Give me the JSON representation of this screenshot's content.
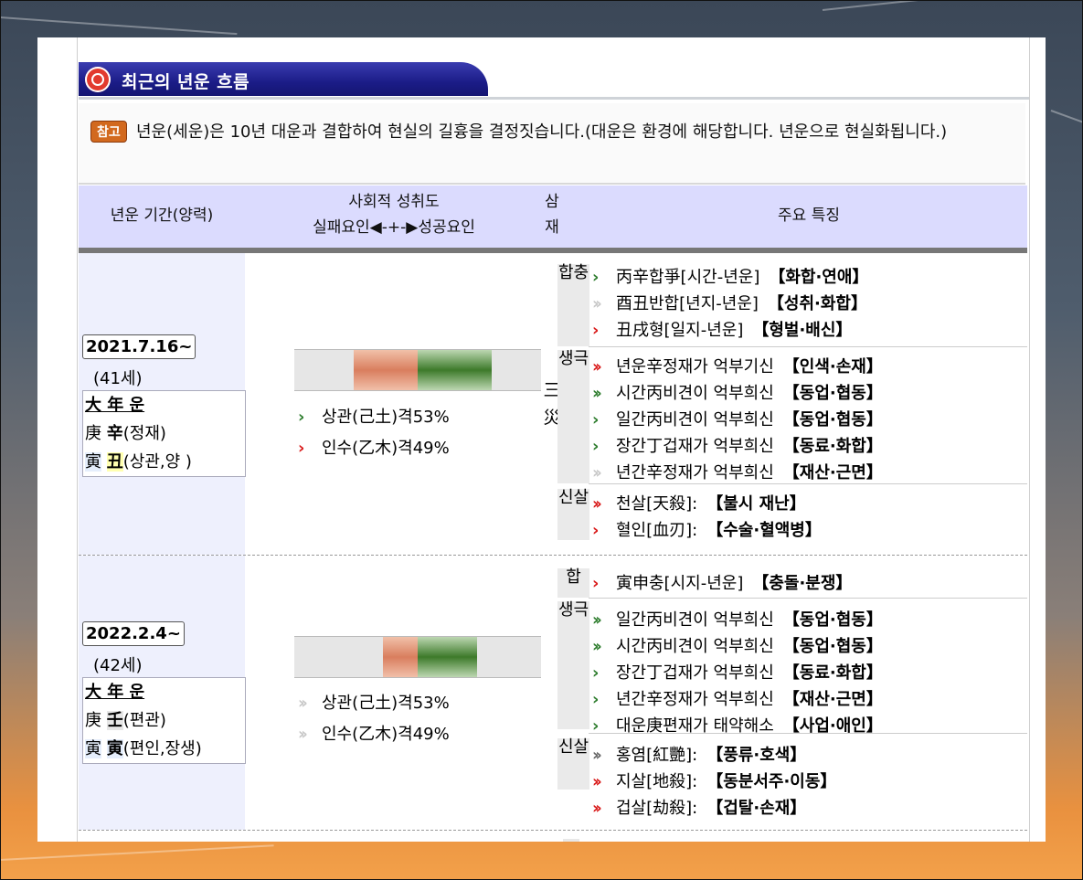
{
  "section_title": "최근의 년운 흐름",
  "note": {
    "badge": "참고",
    "text": "년운(세운)은 10년 대운과 결합하여 현실의 길흉을 결정짓습니다.(대운은 환경에 해당합니다. 년운으로 현실화됩니다.)"
  },
  "headers": {
    "period": "년운 기간(양력)",
    "achievement": "사회적 성취도",
    "achievement_scale": "실패요인◀-+-▶성공요인",
    "samjae_1": "삼",
    "samjae_2": "재",
    "features": "주요 특징"
  },
  "rows": [
    {
      "date": "2021.7.16~",
      "age": "(41세)",
      "daewun": {
        "title": "大 年 운",
        "stem": "庚",
        "stem_yn": "辛",
        "stem_rel": "(정재)",
        "branch": "寅",
        "branch_yn": "丑",
        "branch_rel": "(상관,양 )"
      },
      "bar": {
        "red": 0.26,
        "green": 0.3
      },
      "gyeok": [
        {
          "arrow": "green",
          "text": "상관(己土)격53%"
        },
        {
          "arrow": "red",
          "text": "인수(乙木)격49%"
        }
      ],
      "samjae": {
        "c1": "三",
        "c2": "災"
      },
      "categories": {
        "hap": "합충",
        "saeng": "생극",
        "sin": "신살"
      },
      "hap": [
        {
          "arrow": "green",
          "text": "丙辛합爭[시간-년운]",
          "tag": "【화합·연애】"
        },
        {
          "arrow": "gray",
          "text": "酉丑반합[년지-년운]",
          "tag": "【성취·화합】"
        },
        {
          "arrow": "red",
          "text": "丑戌형[일지-년운]",
          "tag": "【형벌·배신】"
        }
      ],
      "saeng": [
        {
          "arrow": "red2",
          "text": "년운辛정재가 억부기신",
          "tag": "【인색·손재】"
        },
        {
          "arrow": "green2",
          "text": "시간丙비견이 억부희신",
          "tag": "【동업·협동】"
        },
        {
          "arrow": "green",
          "text": "일간丙비견이 억부희신",
          "tag": "【동업·협동】"
        },
        {
          "arrow": "green",
          "text": "장간丁겁재가 억부희신",
          "tag": "【동료·화합】"
        },
        {
          "arrow": "gray",
          "text": "년간辛정재가 억부희신",
          "tag": "【재산·근면】"
        }
      ],
      "sin": [
        {
          "arrow": "red2",
          "text": "천살[天殺]:",
          "tag": "【불시 재난】"
        },
        {
          "arrow": "red",
          "text": "혈인[血刃]:",
          "tag": "【수술·혈액병】"
        }
      ]
    },
    {
      "date": "2022.2.4~",
      "age": "(42세)",
      "daewun": {
        "title": "大 年 운",
        "stem": "庚",
        "stem_yn": "壬",
        "stem_rel": "(편관)",
        "branch": "寅",
        "branch_yn": "寅",
        "branch_rel": "(편인,장생)"
      },
      "bar": {
        "red": 0.14,
        "green": 0.24
      },
      "gyeok": [
        {
          "arrow": "gray",
          "text": "상관(己土)격53%"
        },
        {
          "arrow": "gray",
          "text": "인수(乙木)격49%"
        }
      ],
      "categories": {
        "hap": "합",
        "saeng": "생극",
        "sin": "신살"
      },
      "hap": [
        {
          "arrow": "red",
          "text": "寅申충[시지-년운]",
          "tag": "【충돌·분쟁】"
        }
      ],
      "saeng": [
        {
          "arrow": "green2",
          "text": "일간丙비견이 억부희신",
          "tag": "【동업·협동】"
        },
        {
          "arrow": "green2",
          "text": "시간丙비견이 억부희신",
          "tag": "【동업·협동】"
        },
        {
          "arrow": "green",
          "text": "장간丁겁재가 억부희신",
          "tag": "【동료·화합】"
        },
        {
          "arrow": "green",
          "text": "년간辛정재가 억부희신",
          "tag": "【재산·근면】"
        },
        {
          "arrow": "green",
          "text": "대운庚편재가 태약해소",
          "tag": "【사업·애인】"
        }
      ],
      "sin": [
        {
          "arrow": "dark2",
          "text": "홍염[紅艷]:",
          "tag": "【풍류·호색】"
        },
        {
          "arrow": "red2",
          "text": "지살[地殺]:",
          "tag": "【동분서주·이동】"
        },
        {
          "arrow": "red2",
          "text": "겁살[劫殺]:",
          "tag": "【겁탈·손재】"
        }
      ]
    }
  ],
  "arrows": {
    "red": "›",
    "green": "›",
    "gray": "››",
    "red2": "››",
    "green2": "››",
    "dark2": "››"
  }
}
